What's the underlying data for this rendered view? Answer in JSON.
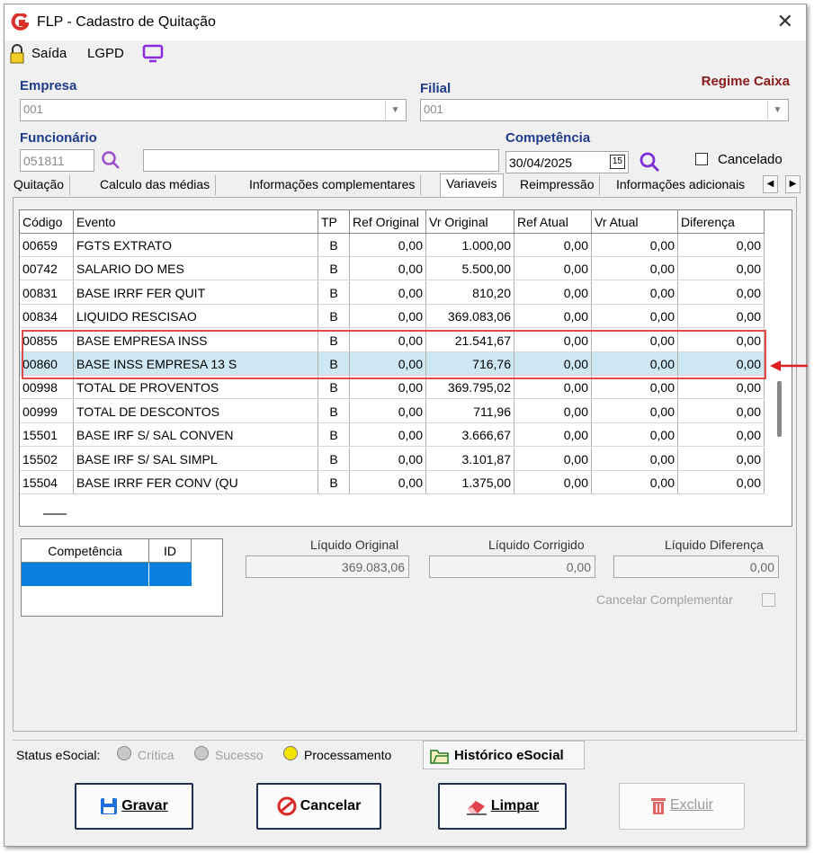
{
  "window": {
    "title": "FLP - Cadastro de Quitação",
    "close": "✕"
  },
  "toolbar": {
    "saida": "Saída",
    "lgpd": "LGPD"
  },
  "empresa": {
    "label": "Empresa",
    "value": "001"
  },
  "filial": {
    "label": "Filial",
    "value": "001"
  },
  "regime": "Regime Caixa",
  "funcionario": {
    "label": "Funcionário",
    "code": "051811",
    "name": ""
  },
  "competencia": {
    "label": "Competência",
    "value": "30/04/2025",
    "cal": "15"
  },
  "cancelado": "Cancelado",
  "tabs": [
    "Quitação",
    "Calculo das médias",
    "Informações complementares",
    "Variaveis",
    "Reimpressão",
    "Informações adicionais"
  ],
  "grid": {
    "headers": [
      "Código",
      "Evento",
      "TP",
      "Ref Original",
      "Vr Original",
      "Ref Atual",
      "Vr Atual",
      "Diferença"
    ],
    "rows": [
      [
        "00659",
        "FGTS EXTRATO",
        "B",
        "0,00",
        "1.000,00",
        "0,00",
        "0,00",
        "0,00"
      ],
      [
        "00742",
        "SALARIO DO MES",
        "B",
        "0,00",
        "5.500,00",
        "0,00",
        "0,00",
        "0,00"
      ],
      [
        "00831",
        "BASE IRRF FER QUIT",
        "B",
        "0,00",
        "810,20",
        "0,00",
        "0,00",
        "0,00"
      ],
      [
        "00834",
        "LIQUIDO RESCISAO",
        "B",
        "0,00",
        "369.083,06",
        "0,00",
        "0,00",
        "0,00"
      ],
      [
        "00855",
        "BASE EMPRESA INSS",
        "B",
        "0,00",
        "21.541,67",
        "0,00",
        "0,00",
        "0,00"
      ],
      [
        "00860",
        "BASE INSS EMPRESA 13 S",
        "B",
        "0,00",
        "716,76",
        "0,00",
        "0,00",
        "0,00"
      ],
      [
        "00998",
        "TOTAL DE PROVENTOS",
        "B",
        "0,00",
        "369.795,02",
        "0,00",
        "0,00",
        "0,00"
      ],
      [
        "00999",
        "TOTAL DE DESCONTOS",
        "B",
        "0,00",
        "711,96",
        "0,00",
        "0,00",
        "0,00"
      ],
      [
        "15501",
        "BASE IRF S/ SAL CONVEN",
        "B",
        "0,00",
        "3.666,67",
        "0,00",
        "0,00",
        "0,00"
      ],
      [
        "15502",
        "BASE IRF S/ SAL SIMPL",
        "B",
        "0,00",
        "3.101,87",
        "0,00",
        "0,00",
        "0,00"
      ],
      [
        "15504",
        "BASE IRRF FER CONV (QU",
        "B",
        "0,00",
        "1.375,00",
        "0,00",
        "0,00",
        "0,00"
      ]
    ],
    "selected_index": 5
  },
  "comp_table": {
    "headers": [
      "Competência",
      "ID"
    ]
  },
  "liquido": {
    "original_label": "Líquido Original",
    "original_value": "369.083,06",
    "corrigido_label": "Líquido Corrigido",
    "corrigido_value": "0,00",
    "diferenca_label": "Líquido Diferença",
    "diferenca_value": "0,00"
  },
  "cancelar_complementar": "Cancelar Complementar",
  "status": {
    "label": "Status eSocial:",
    "critica": "Crítica",
    "sucesso": "Sucesso",
    "processamento": "Processamento",
    "historico": "Histórico eSocial",
    "colors": {
      "critica": "#c8c8c8",
      "sucesso": "#c8c8c8",
      "processamento": "#f5e400"
    }
  },
  "buttons": {
    "gravar": "Gravar",
    "cancelar": "Cancelar",
    "limpar": "Limpar",
    "excluir": "Excluir"
  }
}
